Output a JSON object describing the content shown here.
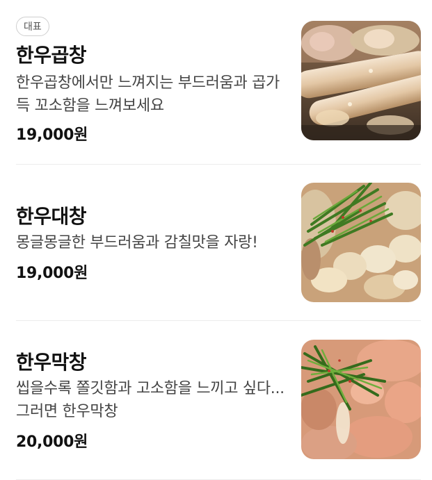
{
  "menu": {
    "items": [
      {
        "badge": "대표",
        "name": "한우곱창",
        "description": "한우곱창에서만 느껴지는 부드러움과 곱가득 꼬소함을 느껴보세요",
        "price": "19,000원",
        "image": "grilled-gopchang-photo"
      },
      {
        "name": "한우대창",
        "description": "몽글몽글한 부드러움과 감칠맛을 자랑!",
        "price": "19,000원",
        "image": "daechang-with-chives-photo"
      },
      {
        "name": "한우막창",
        "description": "씹을수록 쫄깃함과 고소함을 느끼고 싶다...그러면 한우막창",
        "price": "20,000원",
        "image": "makchang-with-chives-photo"
      }
    ]
  }
}
